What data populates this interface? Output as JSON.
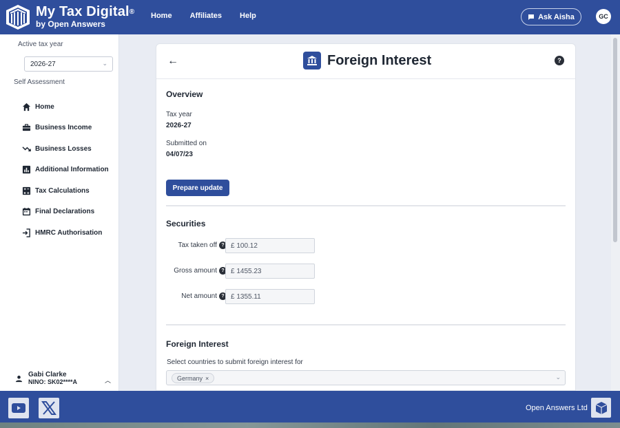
{
  "header": {
    "brand_title": "My Tax Digital",
    "brand_mark": "®",
    "brand_sub": "by Open Answers",
    "nav": [
      "Home",
      "Affiliates",
      "Help"
    ],
    "ask_label": "Ask Aisha",
    "avatar_initials": "GC"
  },
  "sidebar": {
    "active_tax_year_label": "Active tax year",
    "tax_year_value": "2026-27",
    "section_label": "Self Assessment",
    "items": [
      {
        "label": "Home",
        "icon": "home-icon"
      },
      {
        "label": "Business Income",
        "icon": "briefcase-icon"
      },
      {
        "label": "Business Losses",
        "icon": "trending-down-icon"
      },
      {
        "label": "Additional Information",
        "icon": "bar-chart-icon"
      },
      {
        "label": "Tax Calculations",
        "icon": "calculator-icon"
      },
      {
        "label": "Final Declarations",
        "icon": "calendar-icon"
      },
      {
        "label": "HMRC Authorisation",
        "icon": "login-icon"
      }
    ],
    "user_name": "Gabi Clarke",
    "user_nino": "NINO: SK02****A"
  },
  "page": {
    "title": "Foreign Interest",
    "overview_heading": "Overview",
    "tax_year_label": "Tax year",
    "tax_year_value": "2026-27",
    "submitted_label": "Submitted on",
    "submitted_value": "04/07/23",
    "prepare_button": "Prepare update",
    "securities_heading": "Securities",
    "fields": [
      {
        "label": "Tax taken off",
        "value": "£ 100.12"
      },
      {
        "label": "Gross amount",
        "value": "£ 1455.23"
      },
      {
        "label": "Net amount",
        "value": "£ 1355.11"
      }
    ],
    "foreign_heading": "Foreign Interest",
    "countries_label": "Select countries to submit foreign interest for",
    "selected_country": "Germany"
  },
  "footer": {
    "company": "Open Answers Ltd"
  },
  "colors": {
    "brand": "#2f4e9c"
  }
}
